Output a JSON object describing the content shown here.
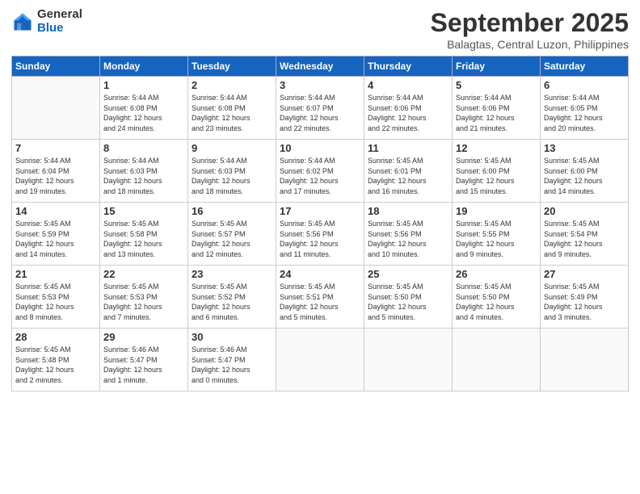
{
  "logo": {
    "general": "General",
    "blue": "Blue"
  },
  "header": {
    "title": "September 2025",
    "subtitle": "Balagtas, Central Luzon, Philippines"
  },
  "weekdays": [
    "Sunday",
    "Monday",
    "Tuesday",
    "Wednesday",
    "Thursday",
    "Friday",
    "Saturday"
  ],
  "weeks": [
    [
      {
        "day": "",
        "info": ""
      },
      {
        "day": "1",
        "info": "Sunrise: 5:44 AM\nSunset: 6:08 PM\nDaylight: 12 hours\nand 24 minutes."
      },
      {
        "day": "2",
        "info": "Sunrise: 5:44 AM\nSunset: 6:08 PM\nDaylight: 12 hours\nand 23 minutes."
      },
      {
        "day": "3",
        "info": "Sunrise: 5:44 AM\nSunset: 6:07 PM\nDaylight: 12 hours\nand 22 minutes."
      },
      {
        "day": "4",
        "info": "Sunrise: 5:44 AM\nSunset: 6:06 PM\nDaylight: 12 hours\nand 22 minutes."
      },
      {
        "day": "5",
        "info": "Sunrise: 5:44 AM\nSunset: 6:06 PM\nDaylight: 12 hours\nand 21 minutes."
      },
      {
        "day": "6",
        "info": "Sunrise: 5:44 AM\nSunset: 6:05 PM\nDaylight: 12 hours\nand 20 minutes."
      }
    ],
    [
      {
        "day": "7",
        "info": "Sunrise: 5:44 AM\nSunset: 6:04 PM\nDaylight: 12 hours\nand 19 minutes."
      },
      {
        "day": "8",
        "info": "Sunrise: 5:44 AM\nSunset: 6:03 PM\nDaylight: 12 hours\nand 18 minutes."
      },
      {
        "day": "9",
        "info": "Sunrise: 5:44 AM\nSunset: 6:03 PM\nDaylight: 12 hours\nand 18 minutes."
      },
      {
        "day": "10",
        "info": "Sunrise: 5:44 AM\nSunset: 6:02 PM\nDaylight: 12 hours\nand 17 minutes."
      },
      {
        "day": "11",
        "info": "Sunrise: 5:45 AM\nSunset: 6:01 PM\nDaylight: 12 hours\nand 16 minutes."
      },
      {
        "day": "12",
        "info": "Sunrise: 5:45 AM\nSunset: 6:00 PM\nDaylight: 12 hours\nand 15 minutes."
      },
      {
        "day": "13",
        "info": "Sunrise: 5:45 AM\nSunset: 6:00 PM\nDaylight: 12 hours\nand 14 minutes."
      }
    ],
    [
      {
        "day": "14",
        "info": "Sunrise: 5:45 AM\nSunset: 5:59 PM\nDaylight: 12 hours\nand 14 minutes."
      },
      {
        "day": "15",
        "info": "Sunrise: 5:45 AM\nSunset: 5:58 PM\nDaylight: 12 hours\nand 13 minutes."
      },
      {
        "day": "16",
        "info": "Sunrise: 5:45 AM\nSunset: 5:57 PM\nDaylight: 12 hours\nand 12 minutes."
      },
      {
        "day": "17",
        "info": "Sunrise: 5:45 AM\nSunset: 5:56 PM\nDaylight: 12 hours\nand 11 minutes."
      },
      {
        "day": "18",
        "info": "Sunrise: 5:45 AM\nSunset: 5:56 PM\nDaylight: 12 hours\nand 10 minutes."
      },
      {
        "day": "19",
        "info": "Sunrise: 5:45 AM\nSunset: 5:55 PM\nDaylight: 12 hours\nand 9 minutes."
      },
      {
        "day": "20",
        "info": "Sunrise: 5:45 AM\nSunset: 5:54 PM\nDaylight: 12 hours\nand 9 minutes."
      }
    ],
    [
      {
        "day": "21",
        "info": "Sunrise: 5:45 AM\nSunset: 5:53 PM\nDaylight: 12 hours\nand 8 minutes."
      },
      {
        "day": "22",
        "info": "Sunrise: 5:45 AM\nSunset: 5:53 PM\nDaylight: 12 hours\nand 7 minutes."
      },
      {
        "day": "23",
        "info": "Sunrise: 5:45 AM\nSunset: 5:52 PM\nDaylight: 12 hours\nand 6 minutes."
      },
      {
        "day": "24",
        "info": "Sunrise: 5:45 AM\nSunset: 5:51 PM\nDaylight: 12 hours\nand 5 minutes."
      },
      {
        "day": "25",
        "info": "Sunrise: 5:45 AM\nSunset: 5:50 PM\nDaylight: 12 hours\nand 5 minutes."
      },
      {
        "day": "26",
        "info": "Sunrise: 5:45 AM\nSunset: 5:50 PM\nDaylight: 12 hours\nand 4 minutes."
      },
      {
        "day": "27",
        "info": "Sunrise: 5:45 AM\nSunset: 5:49 PM\nDaylight: 12 hours\nand 3 minutes."
      }
    ],
    [
      {
        "day": "28",
        "info": "Sunrise: 5:45 AM\nSunset: 5:48 PM\nDaylight: 12 hours\nand 2 minutes."
      },
      {
        "day": "29",
        "info": "Sunrise: 5:46 AM\nSunset: 5:47 PM\nDaylight: 12 hours\nand 1 minute."
      },
      {
        "day": "30",
        "info": "Sunrise: 5:46 AM\nSunset: 5:47 PM\nDaylight: 12 hours\nand 0 minutes."
      },
      {
        "day": "",
        "info": ""
      },
      {
        "day": "",
        "info": ""
      },
      {
        "day": "",
        "info": ""
      },
      {
        "day": "",
        "info": ""
      }
    ]
  ]
}
